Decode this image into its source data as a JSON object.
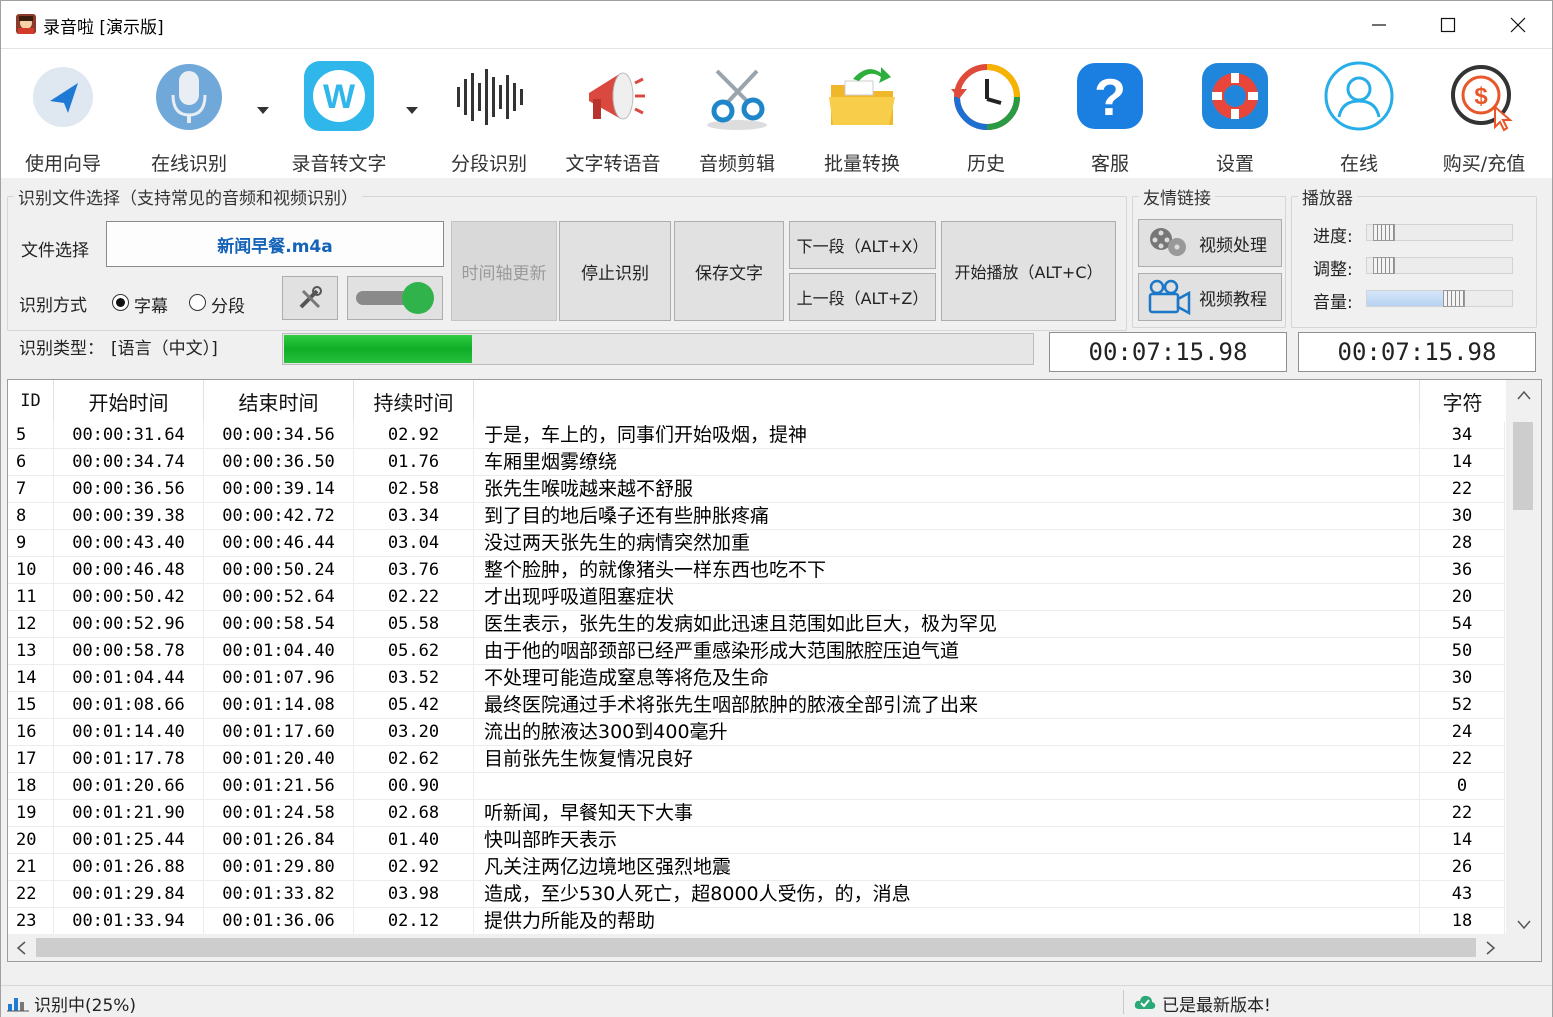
{
  "window": {
    "title": "录音啦 [演示版]",
    "minimize": "—",
    "maximize": "☐",
    "close": "✕"
  },
  "toolbar": {
    "items": [
      {
        "label": "使用向导",
        "icon": "guide-arrow-icon"
      },
      {
        "label": "在线识别",
        "icon": "microphone-icon"
      },
      {
        "label": "录音转文字",
        "icon": "w-logo-icon"
      },
      {
        "label": "分段识别",
        "icon": "waveform-icon"
      },
      {
        "label": "文字转语音",
        "icon": "megaphone-icon"
      },
      {
        "label": "音频剪辑",
        "icon": "scissors-icon"
      },
      {
        "label": "批量转换",
        "icon": "folder-convert-icon"
      },
      {
        "label": "历史",
        "icon": "history-clock-icon"
      },
      {
        "label": "客服",
        "icon": "help-question-icon"
      },
      {
        "label": "设置",
        "icon": "lifebuoy-settings-icon"
      },
      {
        "label": "在线",
        "icon": "user-online-icon"
      },
      {
        "label": "购买/充值",
        "icon": "purchase-coin-icon"
      }
    ]
  },
  "recognition": {
    "group_title": "识别文件选择（支持常见的音频和视频识别）",
    "file_label": "文件选择",
    "file_name": "新闻早餐.m4a",
    "mode_label": "识别方式",
    "mode_subtitle": "字幕",
    "mode_segment": "分段",
    "type_label": "识别类型：",
    "type_value": "[语言（中文）]",
    "btn_timeline": "时间轴更新",
    "btn_stop": "停止识别",
    "btn_save": "保存文字",
    "btn_next": "下一段（ALT+X）",
    "btn_prev": "上一段（ALT+Z）",
    "btn_play": "开始播放（ALT+C）",
    "progress": 0.25,
    "time_left": "00:07:15.98",
    "time_right": "00:07:15.98"
  },
  "links": {
    "group_title": "友情链接",
    "video_process": "视频处理",
    "video_tutorial": "视频教程"
  },
  "player": {
    "group_title": "播放器",
    "progress_label": "进度:",
    "adjust_label": "调整:",
    "volume_label": "音量:",
    "progress_value": 0.0,
    "adjust_value": 0.0,
    "volume_value": 0.6
  },
  "table": {
    "headers": {
      "id": "ID",
      "start": "开始时间",
      "end": "结束时间",
      "dur": "持续时间",
      "text": "",
      "chars": "字符"
    },
    "rows": [
      {
        "id": "5",
        "start": "00:00:31.64",
        "end": "00:00:34.56",
        "dur": "02.92",
        "text": "于是，车上的，同事们开始吸烟，提神",
        "chars": "34"
      },
      {
        "id": "6",
        "start": "00:00:34.74",
        "end": "00:00:36.50",
        "dur": "01.76",
        "text": "车厢里烟雾缭绕",
        "chars": "14"
      },
      {
        "id": "7",
        "start": "00:00:36.56",
        "end": "00:00:39.14",
        "dur": "02.58",
        "text": "张先生喉咙越来越不舒服",
        "chars": "22"
      },
      {
        "id": "8",
        "start": "00:00:39.38",
        "end": "00:00:42.72",
        "dur": "03.34",
        "text": "到了目的地后嗓子还有些肿胀疼痛",
        "chars": "30"
      },
      {
        "id": "9",
        "start": "00:00:43.40",
        "end": "00:00:46.44",
        "dur": "03.04",
        "text": "没过两天张先生的病情突然加重",
        "chars": "28"
      },
      {
        "id": "10",
        "start": "00:00:46.48",
        "end": "00:00:50.24",
        "dur": "03.76",
        "text": "整个脸肿，的就像猪头一样东西也吃不下",
        "chars": "36"
      },
      {
        "id": "11",
        "start": "00:00:50.42",
        "end": "00:00:52.64",
        "dur": "02.22",
        "text": "才出现呼吸道阻塞症状",
        "chars": "20"
      },
      {
        "id": "12",
        "start": "00:00:52.96",
        "end": "00:00:58.54",
        "dur": "05.58",
        "text": "医生表示，张先生的发病如此迅速且范围如此巨大，极为罕见",
        "chars": "54"
      },
      {
        "id": "13",
        "start": "00:00:58.78",
        "end": "00:01:04.40",
        "dur": "05.62",
        "text": "由于他的咽部颈部已经严重感染形成大范围脓腔压迫气道",
        "chars": "50"
      },
      {
        "id": "14",
        "start": "00:01:04.44",
        "end": "00:01:07.96",
        "dur": "03.52",
        "text": "不处理可能造成窒息等将危及生命",
        "chars": "30"
      },
      {
        "id": "15",
        "start": "00:01:08.66",
        "end": "00:01:14.08",
        "dur": "05.42",
        "text": "最终医院通过手术将张先生咽部脓肿的脓液全部引流了出来",
        "chars": "52"
      },
      {
        "id": "16",
        "start": "00:01:14.40",
        "end": "00:01:17.60",
        "dur": "03.20",
        "text": "流出的脓液达300到400毫升",
        "chars": "24"
      },
      {
        "id": "17",
        "start": "00:01:17.78",
        "end": "00:01:20.40",
        "dur": "02.62",
        "text": "目前张先生恢复情况良好",
        "chars": "22"
      },
      {
        "id": "18",
        "start": "00:01:20.66",
        "end": "00:01:21.56",
        "dur": "00.90",
        "text": "",
        "chars": "0"
      },
      {
        "id": "19",
        "start": "00:01:21.90",
        "end": "00:01:24.58",
        "dur": "02.68",
        "text": "听新闻，早餐知天下大事",
        "chars": "22"
      },
      {
        "id": "20",
        "start": "00:01:25.44",
        "end": "00:01:26.84",
        "dur": "01.40",
        "text": "快叫部昨天表示",
        "chars": "14"
      },
      {
        "id": "21",
        "start": "00:01:26.88",
        "end": "00:01:29.80",
        "dur": "02.92",
        "text": "凡关注两亿边境地区强烈地震",
        "chars": "26"
      },
      {
        "id": "22",
        "start": "00:01:29.84",
        "end": "00:01:33.82",
        "dur": "03.98",
        "text": "造成，至少530人死亡，超8000人受伤，的，消息",
        "chars": "43"
      },
      {
        "id": "23",
        "start": "00:01:33.94",
        "end": "00:01:36.06",
        "dur": "02.12",
        "text": "提供力所能及的帮助",
        "chars": "18"
      }
    ]
  },
  "status": {
    "left": "识别中(25%)",
    "right": "已是最新版本!"
  },
  "colors": {
    "accent_blue": "#1463b9",
    "progress_green": "#13b42c"
  }
}
